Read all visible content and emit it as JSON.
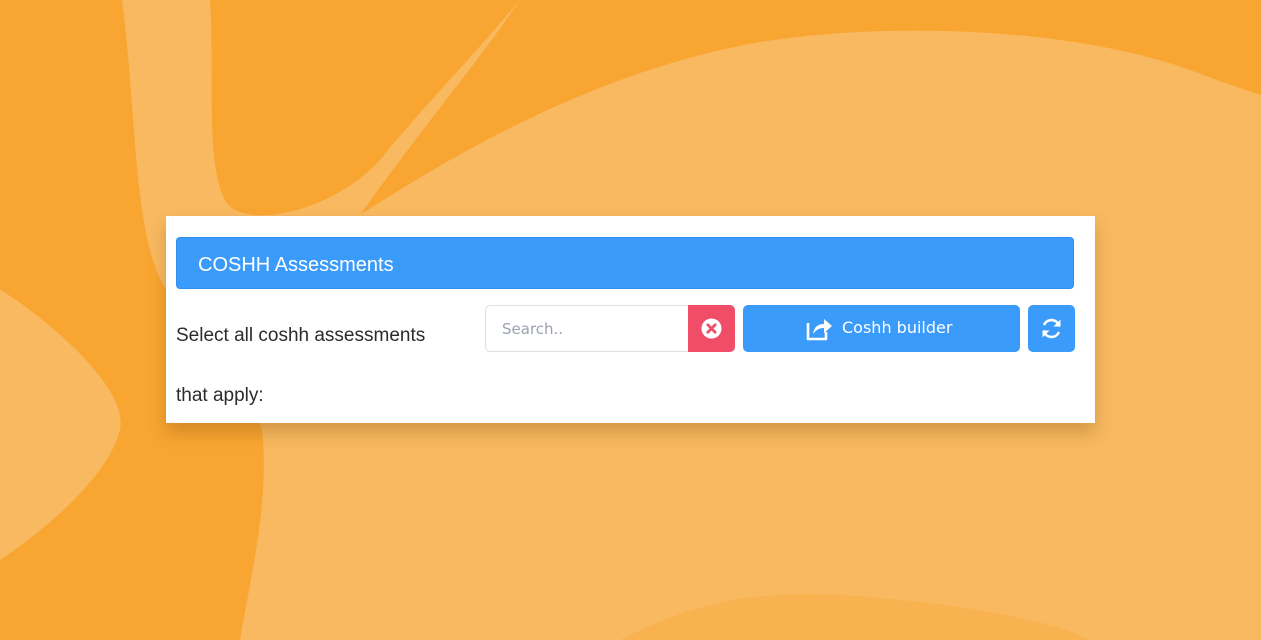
{
  "panel": {
    "title": "COSHH Assessments",
    "instruction_line_1": "Select all coshh assessments",
    "instruction_line_2": "that apply:"
  },
  "search": {
    "placeholder": "Search..",
    "value": ""
  },
  "toolbar": {
    "clear_icon": "times-circle-icon",
    "builder_label": "Coshh builder",
    "builder_icon": "share-square-icon",
    "refresh_icon": "refresh-icon"
  },
  "colors": {
    "background": "#F8B960",
    "background_accent": "#F9A531",
    "header": "#3A9BFB",
    "primary_button": "#3A9BFB",
    "clear_button": "#F04E68"
  }
}
